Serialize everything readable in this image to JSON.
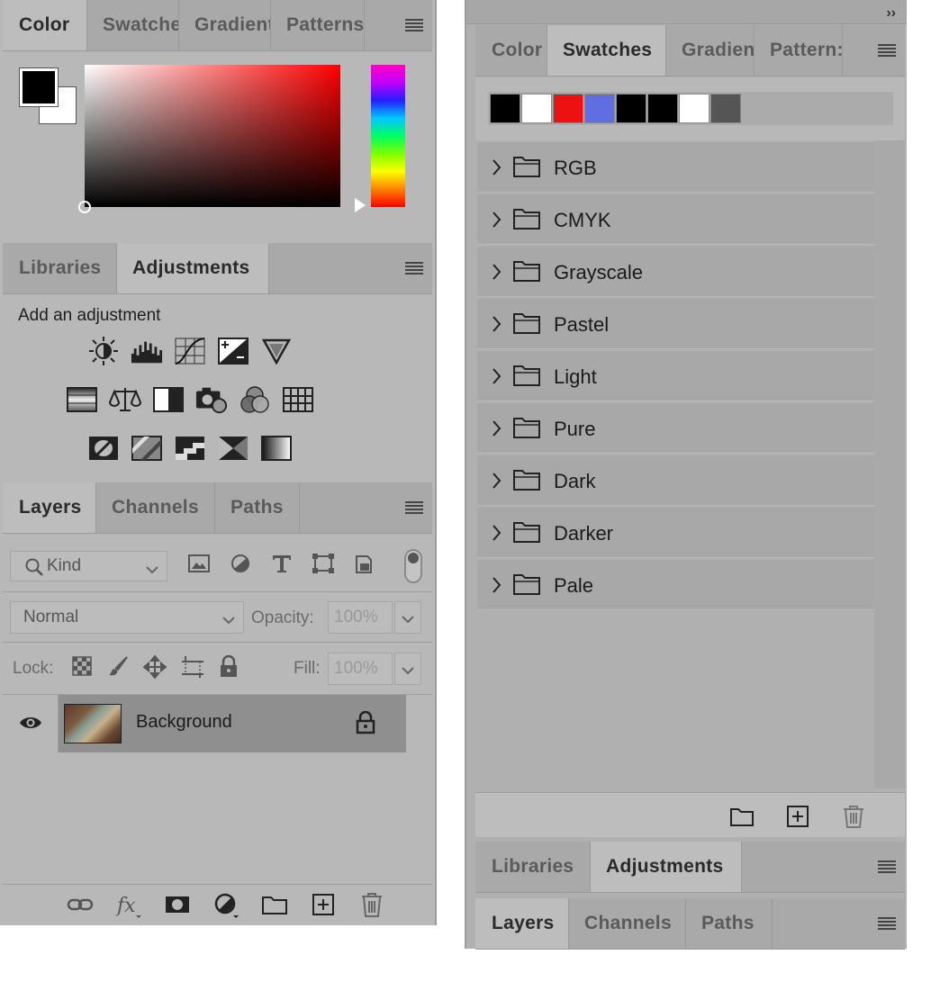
{
  "left": {
    "color_panel": {
      "tabs": [
        "Color",
        "Swatche",
        "Gradient",
        "Patterns"
      ],
      "active_tab": "Color"
    },
    "adjustments_panel": {
      "tabs": [
        "Libraries",
        "Adjustments"
      ],
      "title": "Add an adjustment",
      "icons_row1": [
        "brightness-contrast-icon",
        "levels-icon",
        "curves-icon",
        "exposure-icon",
        "vibrance-icon"
      ],
      "icons_row2": [
        "hue-saturation-icon",
        "color-balance-icon",
        "black-white-icon",
        "photo-filter-icon",
        "channel-mixer-icon",
        "color-lookup-icon"
      ],
      "icons_row3": [
        "invert-icon",
        "posterize-icon",
        "threshold-icon",
        "selective-color-icon",
        "gradient-map-icon"
      ]
    },
    "layers_panel": {
      "tabs": [
        "Layers",
        "Channels",
        "Paths"
      ],
      "kind_label": "Kind",
      "blend_mode": "Normal",
      "opacity_label": "Opacity:",
      "opacity_value": "100%",
      "lock_label": "Lock:",
      "fill_label": "Fill:",
      "fill_value": "100%",
      "layer_name": "Background"
    }
  },
  "right": {
    "collapse_glyph": "››",
    "swatches_panel": {
      "tabs": [
        "Color",
        "Swatches",
        "Gradien",
        "Pattern:"
      ],
      "active_tab": "Swatches",
      "recent_swatches": [
        "#000000",
        "#ffffff",
        "#ee1111",
        "#5f6fe0",
        "#000000",
        "#000000",
        "#ffffff",
        "#555555"
      ],
      "groups": [
        "RGB",
        "CMYK",
        "Grayscale",
        "Pastel",
        "Light",
        "Pure",
        "Dark",
        "Darker",
        "Pale"
      ]
    },
    "adjustments_tabs": [
      "Libraries",
      "Adjustments"
    ],
    "layers_tabs": [
      "Layers",
      "Channels",
      "Paths"
    ]
  }
}
